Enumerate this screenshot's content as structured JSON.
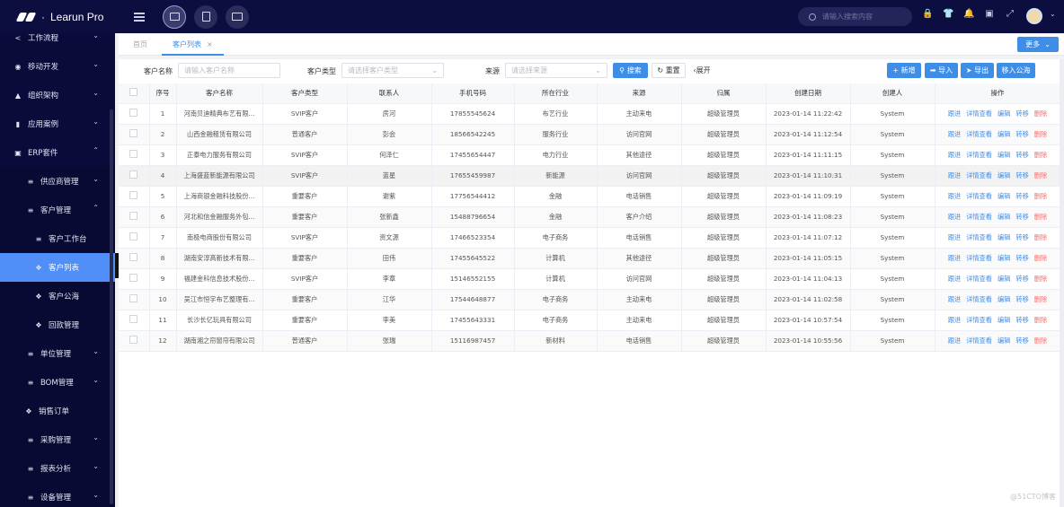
{
  "app": {
    "name": "Learun Pro"
  },
  "topbar": {
    "search_placeholder": "请输入搜索内容",
    "icons": [
      "lock-icon",
      "shirt-icon",
      "bell-icon",
      "translate-icon",
      "fullscreen-icon"
    ]
  },
  "sidebar": {
    "items": [
      {
        "label": "工作流程",
        "icon": "share-icon",
        "level": 1,
        "chevron": "down"
      },
      {
        "label": "移动开发",
        "icon": "github-icon",
        "level": 1,
        "chevron": "down"
      },
      {
        "label": "组织架构",
        "icon": "org-icon",
        "level": 1,
        "chevron": "down"
      },
      {
        "label": "应用案例",
        "icon": "file-icon",
        "level": 1,
        "chevron": "down"
      },
      {
        "label": "ERP套件",
        "icon": "briefcase-icon",
        "level": 1,
        "chevron": "up"
      },
      {
        "label": "供应商管理",
        "icon": "menu-icon",
        "level": 2,
        "chevron": "down"
      },
      {
        "label": "客户管理",
        "icon": "menu-icon",
        "level": 2,
        "chevron": "up"
      },
      {
        "label": "客户工作台",
        "icon": "menu-icon",
        "level": 3
      },
      {
        "label": "客户列表",
        "icon": "cube-icon",
        "level": 3,
        "active": true
      },
      {
        "label": "客户公海",
        "icon": "cube-icon",
        "level": 3
      },
      {
        "label": "回款管理",
        "icon": "cube-icon",
        "level": 3
      },
      {
        "label": "单位管理",
        "icon": "menu-icon",
        "level": 2,
        "chevron": "down"
      },
      {
        "label": "BOM管理",
        "icon": "menu-icon",
        "level": 2,
        "chevron": "down"
      },
      {
        "label": "销售订单",
        "icon": "cube-icon",
        "level": 2
      },
      {
        "label": "采购管理",
        "icon": "menu-icon",
        "level": 2,
        "chevron": "down"
      },
      {
        "label": "报表分析",
        "icon": "menu-icon",
        "level": 2,
        "chevron": "down"
      },
      {
        "label": "设备管理",
        "icon": "menu-icon",
        "level": 2,
        "chevron": "down"
      }
    ]
  },
  "tabs": {
    "home": "首页",
    "active": "客户列表",
    "close": "×",
    "more": "更多"
  },
  "filter": {
    "name_label": "客户名称",
    "name_placeholder": "请输入客户名称",
    "type_label": "客户类型",
    "type_placeholder": "请选择客户类型",
    "source_label": "来源",
    "source_placeholder": "请选择来源",
    "search": "搜索",
    "reset": "重置",
    "expand": "展开",
    "add": "新增",
    "import": "导入",
    "export": "导出",
    "to_pool": "移入公海"
  },
  "table": {
    "columns": [
      "序号",
      "客户名称",
      "客户类型",
      "联系人",
      "手机号码",
      "所在行业",
      "来源",
      "归属",
      "创建日期",
      "创建人",
      "操作"
    ],
    "actions": [
      "跟进",
      "详情查看",
      "编辑",
      "转移",
      "删除"
    ],
    "rows": [
      [
        "1",
        "河南贝迪精典布艺有限...",
        "SVIP客户",
        "房河",
        "17855545624",
        "布艺行业",
        "主动来电",
        "超级管理员",
        "2023-01-14 11:22:42",
        "System"
      ],
      [
        "2",
        "山西金融租赁有限公司",
        "普通客户",
        "彭会",
        "18566542245",
        "服务行业",
        "访问官网",
        "超级管理员",
        "2023-01-14 11:12:54",
        "System"
      ],
      [
        "3",
        "正泰电力服务有限公司",
        "SVIP客户",
        "何泽仁",
        "17455654447",
        "电力行业",
        "其他途径",
        "超级管理员",
        "2023-01-14 11:11:15",
        "System"
      ],
      [
        "4",
        "上海盛蓝新能源有限公司",
        "SVIP客户",
        "蓝星",
        "17655459987",
        "新能源",
        "访问官网",
        "超级管理员",
        "2023-01-14 11:10:31",
        "System"
      ],
      [
        "5",
        "上海商银金融科技股份...",
        "重要客户",
        "谢紫",
        "17756544412",
        "金融",
        "电话销售",
        "超级管理员",
        "2023-01-14 11:09:19",
        "System"
      ],
      [
        "6",
        "河北和信金融服务外包...",
        "重要客户",
        "张新鑫",
        "15488796654",
        "金融",
        "客户介绍",
        "超级管理员",
        "2023-01-14 11:08:23",
        "System"
      ],
      [
        "7",
        "南极电商股份有限公司",
        "SVIP客户",
        "资文源",
        "17466523354",
        "电子商务",
        "电话销售",
        "超级管理员",
        "2023-01-14 11:07:12",
        "System"
      ],
      [
        "8",
        "湖南安淳高新技术有限...",
        "重要客户",
        "田伟",
        "17455645522",
        "计算机",
        "其他途径",
        "超级管理员",
        "2023-01-14 11:05:15",
        "System"
      ],
      [
        "9",
        "福建金科信息技术股份...",
        "SVIP客户",
        "李章",
        "15146552155",
        "计算机",
        "访问官网",
        "超级管理员",
        "2023-01-14 11:04:13",
        "System"
      ],
      [
        "10",
        "吴江市恒宇布艺整理有...",
        "重要客户",
        "江华",
        "17544648877",
        "电子商务",
        "主动来电",
        "超级管理员",
        "2023-01-14 11:02:58",
        "System"
      ],
      [
        "11",
        "长沙长亿玩具有限公司",
        "重要客户",
        "李美",
        "17455643331",
        "电子商务",
        "主动来电",
        "超级管理员",
        "2023-01-14 10:57:54",
        "System"
      ],
      [
        "12",
        "湖南湘之帘窗帘有限公司",
        "普通客户",
        "张瑞",
        "15116987457",
        "新材料",
        "电话销售",
        "超级管理员",
        "2023-01-14 10:55:56",
        "System"
      ]
    ]
  },
  "colors": {
    "primary": "#3e8ee8",
    "danger": "#f56c6c",
    "topbar": "#0d0e40",
    "sidebar": "#0a0b3b",
    "active_menu": "#4f8ff7"
  },
  "watermark": "@51CTO博客"
}
